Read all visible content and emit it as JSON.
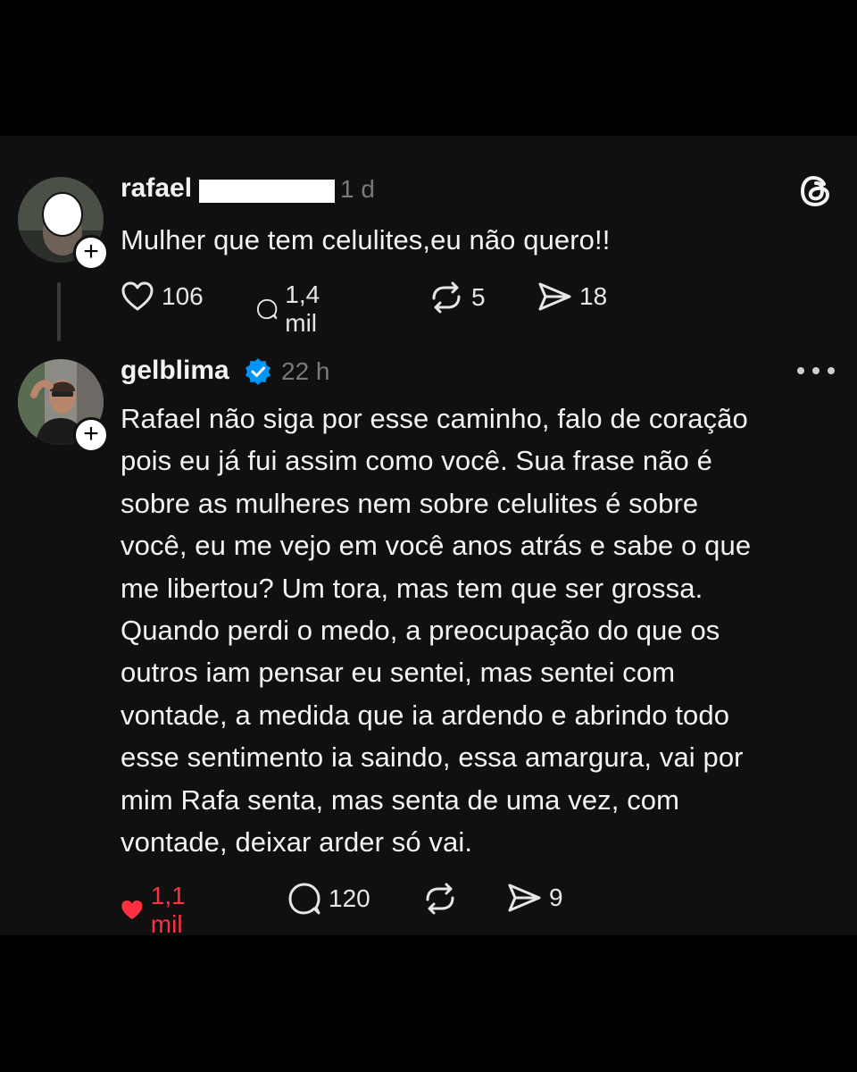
{
  "posts": [
    {
      "username_visible": "rafael",
      "time": "1 d",
      "text": "Mulher que tem celulites,eu não quero!!",
      "likes": "106",
      "replies": "1,4 mil",
      "reposts": "5",
      "shares": "18",
      "liked": false
    },
    {
      "username": "gelblima",
      "verified": true,
      "time": "22 h",
      "text_lines": [
        "Rafael não siga por esse caminho, falo de coração",
        "pois eu já fui assim como você. Sua frase não é",
        "sobre as mulheres nem sobre celulites é sobre",
        "você, eu me vejo em você anos atrás e sabe o que",
        "me libertou? Um tora, mas tem que ser grossa.",
        "Quando perdi o medo, a preocupação do que os",
        "outros iam pensar eu sentei, mas sentei com",
        "vontade, a medida que ia ardendo e abrindo todo",
        "esse sentimento ia saindo, essa amargura, vai por",
        "mim Rafa senta, mas senta de uma vez, com",
        "vontade, deixar arder só vai."
      ],
      "likes": "1,1 mil",
      "replies": "120",
      "shares": "9",
      "liked": true
    }
  ],
  "icons": {
    "like": "heart-icon",
    "reply": "comment-icon",
    "repost": "repost-icon",
    "share": "send-icon",
    "app": "threads-logo-icon",
    "more": "more-options-icon",
    "follow": "plus-icon",
    "verified": "verified-badge-icon"
  },
  "colors": {
    "background": "#000000",
    "panel": "#101010",
    "text": "#f3f3f3",
    "muted": "#7a7a7a",
    "liked": "#ff3040",
    "verified": "#0095f6"
  }
}
